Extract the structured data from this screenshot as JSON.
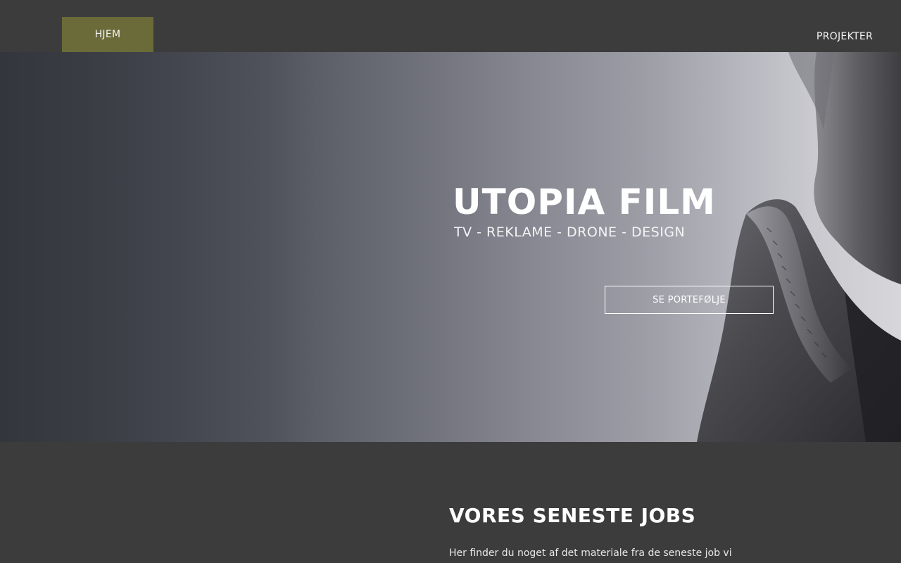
{
  "nav": {
    "home_label": "HJEM",
    "projects_label": "PROJEKTER",
    "active_color": "#6b6b3a"
  },
  "hero": {
    "title": "UTOPIA FILM",
    "subtitle": "TV - REKLAME - DRONE - DESIGN",
    "cta_label": "SE PORTEFØLJE"
  },
  "section": {
    "title": "VORES SENESTE JOBS",
    "text": "Her finder du noget af det materiale fra de seneste job vi"
  }
}
